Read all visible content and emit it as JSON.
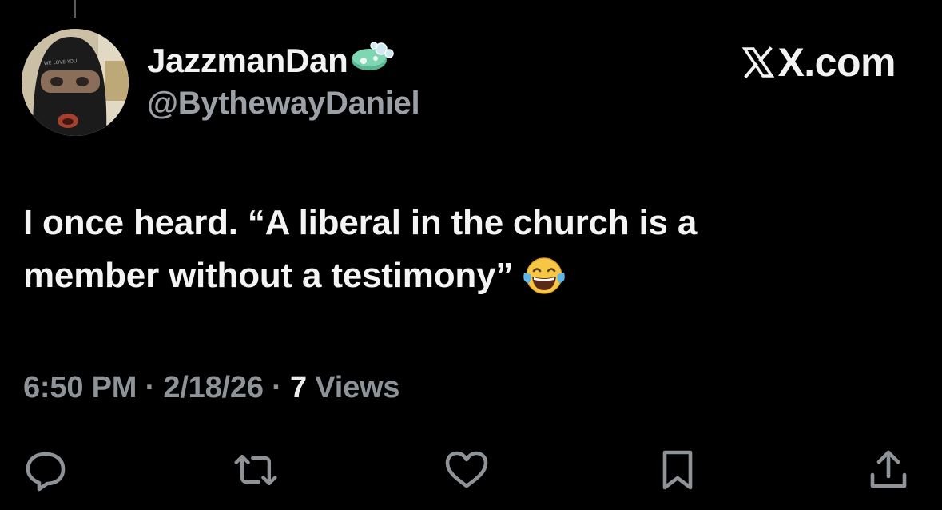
{
  "author": {
    "display_name": "JazzmanDan",
    "handle": "@BythewayDaniel",
    "avatar_mask_text": "WE LOVE YOU"
  },
  "source": {
    "label": "X.com"
  },
  "tweet": {
    "lines": [
      "I once heard. “A liberal in the church is a",
      "member without a testimony”"
    ],
    "emoji": "face-with-tears-of-joy"
  },
  "meta": {
    "time": "6:50 PM",
    "sep1": " · ",
    "date": "2/18/26",
    "sep2": " · ",
    "views_count": "7",
    "views_label": " Views"
  },
  "actions": [
    {
      "name": "reply",
      "icon": "reply-icon"
    },
    {
      "name": "repost",
      "icon": "repost-icon"
    },
    {
      "name": "like",
      "icon": "heart-icon"
    },
    {
      "name": "bookmark",
      "icon": "bookmark-icon"
    },
    {
      "name": "share",
      "icon": "share-icon"
    }
  ],
  "colors": {
    "background": "#000000",
    "text": "#f4f4f4",
    "secondary": "#8e9398",
    "soap": "#7fd6b3"
  }
}
